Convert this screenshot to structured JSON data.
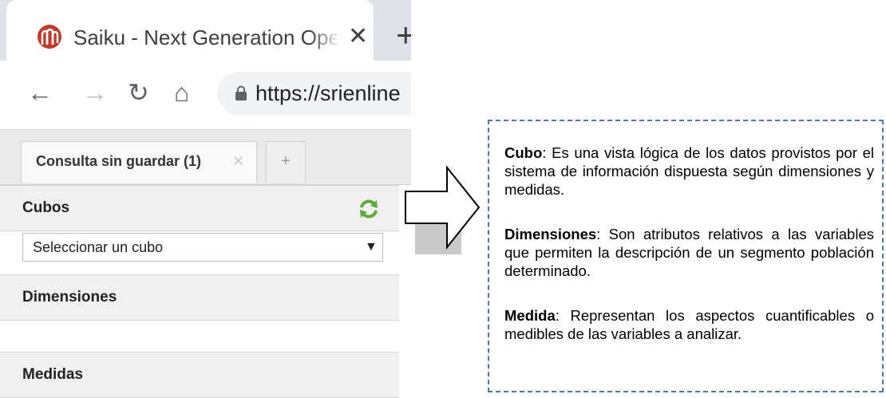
{
  "browser": {
    "tab_title": "Saiku - Next Generation Open Sc",
    "new_tab_symbol": "+",
    "url": "https://srienline"
  },
  "saiku": {
    "query_tab": "Consulta sin guardar (1)",
    "add_tab_symbol": "+",
    "sidebar": {
      "cubes_header": "Cubos",
      "cube_select_value": "Seleccionar un cubo",
      "dimensions_header": "Dimensiones",
      "measures_header": "Medidas"
    }
  },
  "callout": {
    "cubo": {
      "term": "Cubo",
      "text": ": Es una vista lógica de los datos provistos por el sistema de información dispuesta según dimensiones y medidas."
    },
    "dimensiones": {
      "term": "Dimensiones",
      "text": ": Son atributos relativos a las variables que permiten la descripción de un segmento población determinado."
    },
    "medida": {
      "term": "Medida",
      "text": ":  Representan los aspectos cuantificables o medibles de las variables a analizar."
    }
  },
  "colors": {
    "callout_border": "#4f78b0",
    "favicon_red": "#c0392b",
    "refresh_green": "#5aab3a"
  },
  "icons": [
    "saiku-favicon-icon",
    "close-icon",
    "new-tab-icon",
    "back-icon",
    "forward-icon",
    "reload-icon",
    "home-icon",
    "lock-icon",
    "refresh-icon",
    "chevron-down-icon",
    "arrow-right-icon"
  ]
}
